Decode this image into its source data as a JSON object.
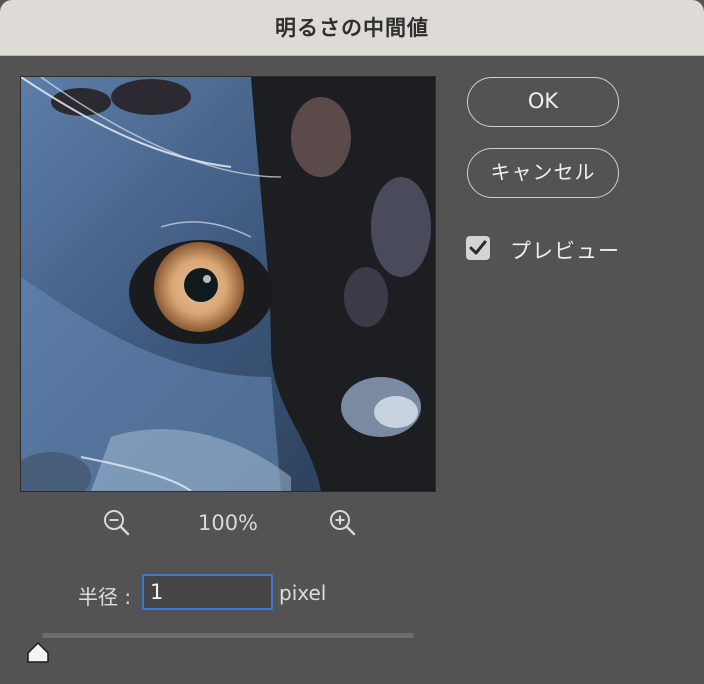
{
  "dialog": {
    "title": "明るさの中間値"
  },
  "preview": {
    "zoom_level": "100%"
  },
  "radius": {
    "label": "半径 :",
    "value": "1",
    "unit": "pixel",
    "slider_fraction": 0.0
  },
  "buttons": {
    "ok_label": "OK",
    "cancel_label": "キャンセル"
  },
  "preview_toggle": {
    "label": "プレビュー",
    "checked": true
  },
  "icons": {
    "zoom_out": "magnifier-minus-icon",
    "zoom_in": "magnifier-plus-icon",
    "check": "checkmark-icon"
  },
  "colors": {
    "focus_ring": "#3d78d6",
    "titlebar": "#dedad5",
    "panel": "#535353"
  }
}
